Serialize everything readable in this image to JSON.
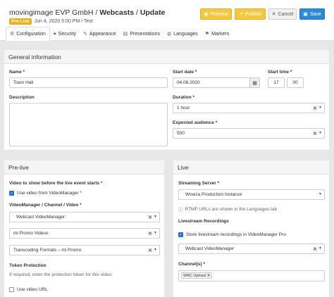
{
  "header": {
    "title_org": "movingimage EVP GmbH",
    "title_sep1": " / ",
    "title_section": "Webcasts",
    "title_sep2": " / ",
    "title_page": "Update",
    "status_badge": "Pre-Live",
    "meta": "Jun 4, 2020 5:00 PM / Test"
  },
  "actions": {
    "preview": "Preview",
    "publish": "Publish",
    "cancel": "Cancel",
    "save": "Save"
  },
  "tabs": [
    {
      "label": "Configuration",
      "icon": "gear-icon",
      "active": true
    },
    {
      "label": "Security",
      "icon": "lock-icon"
    },
    {
      "label": "Appearance",
      "icon": "brush-icon"
    },
    {
      "label": "Presentations",
      "icon": "document-icon"
    },
    {
      "label": "Languages",
      "icon": "globe-icon"
    },
    {
      "label": "Markers",
      "icon": "marker-icon"
    }
  ],
  "general": {
    "heading": "General information",
    "name_label": "Name *",
    "name_value": "Town Hall",
    "description_label": "Description",
    "start_date_label": "Start date *",
    "start_date_value": "04.06.2020",
    "start_time_label": "Start time *",
    "start_hour": "17",
    "start_minute": "00",
    "duration_label": "Duration *",
    "duration_value": "1 hour",
    "audience_label": "Expected audience *",
    "audience_value": "500"
  },
  "prelive": {
    "heading": "Pre-live",
    "video_label": "Video to show before the live event starts *",
    "use_vm_label": "Use video from VideoManager *",
    "use_vm_checked": true,
    "channel_label": "VideoManager / Channel / Video *",
    "vm_value": "Webcast VideoManager",
    "channel_value": "mi Promo Videos",
    "video_value": "Transcoding Formats – mi Promo",
    "token_label": "Token Protection",
    "token_hint": "If required, enter the protection token for this video.",
    "use_url_label": "Use video URL",
    "use_url_checked": false
  },
  "live": {
    "heading": "Live",
    "server_label": "Streaming Server *",
    "server_value": "Wowza Production Instance",
    "rtmp_hint": "RTMP URLs are shown in the Languages tab",
    "recordings_label": "Livestream Recordings",
    "store_label": "Store livestream recordings in VideoManager Pro",
    "store_checked": true,
    "recording_vm_value": "Webcast VideoManager",
    "channels_label": "Channel(s) *",
    "channel_tag": "WBC Upload"
  }
}
